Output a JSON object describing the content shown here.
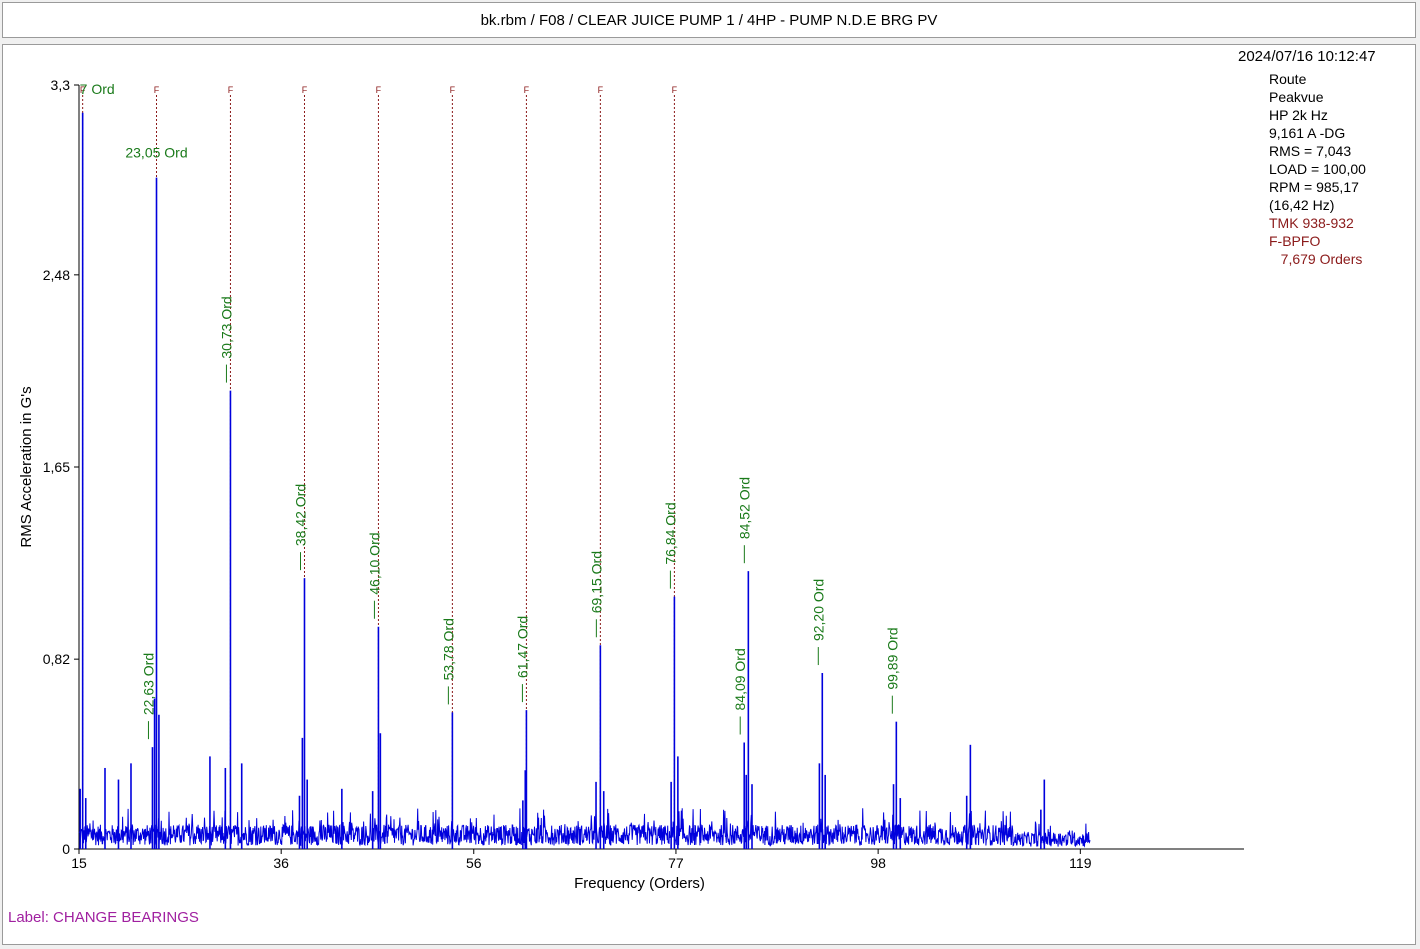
{
  "window": {
    "title": "bk.rbm / F08 / CLEAR JUICE PUMP 1 / 4HP - PUMP N.D.E BRG PV"
  },
  "info": {
    "timestamp": "2024/07/16 10:12:47",
    "lines": [
      "Route",
      "Peakvue",
      "HP 2k Hz",
      "9,161 A -DG",
      "RMS = 7,043",
      "LOAD = 100,00",
      "RPM = 985,17",
      "(16,42 Hz)"
    ],
    "fault_lines": [
      "TMK 938-932",
      "F-BPFO",
      "   7,679 Orders"
    ],
    "fault_color": "#8b1a1a"
  },
  "footer": {
    "label": "Label: CHANGE BEARINGS"
  },
  "chart_data": {
    "type": "line",
    "xlabel": "Frequency (Orders)",
    "ylabel": "RMS Acceleration in G's",
    "x_range": [
      15,
      136
    ],
    "y_range": [
      0,
      3.3
    ],
    "x_ticks": [
      15,
      36,
      56,
      77,
      98,
      119
    ],
    "x_tick_labels": [
      "15",
      "36",
      "56",
      "77",
      "98",
      "119"
    ],
    "y_ticks": [
      0,
      0.82,
      1.65,
      2.48,
      3.3
    ],
    "y_tick_labels": [
      "0",
      "0,82",
      "1,65",
      "2,48",
      "3,3"
    ],
    "series_color": "#0000dd",
    "marker_color": "#8b1a1a",
    "label_color": "#1a7a1a",
    "fault_markers": {
      "label": "F",
      "x": [
        15.38,
        23.05,
        30.73,
        38.42,
        46.1,
        53.78,
        61.47,
        69.15,
        76.84
      ]
    },
    "peak_labels": [
      {
        "x": 15.38,
        "y": 3.18,
        "text": "7 Ord",
        "orient": "h"
      },
      {
        "x": 23.05,
        "y": 2.9,
        "text": "23,05 Ord",
        "orient": "h"
      },
      {
        "x": 22.63,
        "y": 0.44,
        "text": "22,63 Ord",
        "orient": "v"
      },
      {
        "x": 30.73,
        "y": 1.98,
        "text": "30,73 Ord",
        "orient": "v"
      },
      {
        "x": 38.42,
        "y": 1.17,
        "text": "38,42 Ord",
        "orient": "v"
      },
      {
        "x": 46.1,
        "y": 0.96,
        "text": "46,10 Ord",
        "orient": "v"
      },
      {
        "x": 53.78,
        "y": 0.59,
        "text": "53,78 Ord",
        "orient": "v"
      },
      {
        "x": 61.47,
        "y": 0.6,
        "text": "61,47 Ord",
        "orient": "v"
      },
      {
        "x": 69.15,
        "y": 0.88,
        "text": "69,15 Ord",
        "orient": "v"
      },
      {
        "x": 76.84,
        "y": 1.09,
        "text": "76,84 Ord",
        "orient": "v"
      },
      {
        "x": 84.09,
        "y": 0.46,
        "text": "84,09 Ord",
        "orient": "v"
      },
      {
        "x": 84.52,
        "y": 1.2,
        "text": "84,52 Ord",
        "orient": "v"
      },
      {
        "x": 92.2,
        "y": 0.76,
        "text": "92,20 Ord",
        "orient": "v"
      },
      {
        "x": 99.89,
        "y": 0.55,
        "text": "99,89 Ord",
        "orient": "v"
      }
    ],
    "peaks": [
      {
        "x": 15.38,
        "y": 3.18
      },
      {
        "x": 15.12,
        "y": 0.26
      },
      {
        "x": 15.7,
        "y": 0.22
      },
      {
        "x": 17.7,
        "y": 0.35
      },
      {
        "x": 19.1,
        "y": 0.3
      },
      {
        "x": 20.4,
        "y": 0.37
      },
      {
        "x": 22.63,
        "y": 0.44
      },
      {
        "x": 23.05,
        "y": 2.9
      },
      {
        "x": 22.85,
        "y": 0.65
      },
      {
        "x": 23.3,
        "y": 0.58
      },
      {
        "x": 28.6,
        "y": 0.4
      },
      {
        "x": 30.2,
        "y": 0.35
      },
      {
        "x": 30.73,
        "y": 1.98
      },
      {
        "x": 31.9,
        "y": 0.37
      },
      {
        "x": 37.9,
        "y": 0.23
      },
      {
        "x": 38.2,
        "y": 0.48
      },
      {
        "x": 38.42,
        "y": 1.17
      },
      {
        "x": 38.7,
        "y": 0.3
      },
      {
        "x": 42.3,
        "y": 0.26
      },
      {
        "x": 45.5,
        "y": 0.25
      },
      {
        "x": 46.1,
        "y": 0.96
      },
      {
        "x": 46.3,
        "y": 0.5
      },
      {
        "x": 53.78,
        "y": 0.59
      },
      {
        "x": 61.1,
        "y": 0.21
      },
      {
        "x": 61.47,
        "y": 0.6
      },
      {
        "x": 61.35,
        "y": 0.34
      },
      {
        "x": 68.7,
        "y": 0.29
      },
      {
        "x": 69.15,
        "y": 0.88
      },
      {
        "x": 69.5,
        "y": 0.25
      },
      {
        "x": 76.5,
        "y": 0.29
      },
      {
        "x": 76.84,
        "y": 1.09
      },
      {
        "x": 77.2,
        "y": 0.4
      },
      {
        "x": 84.09,
        "y": 0.46
      },
      {
        "x": 84.52,
        "y": 1.2
      },
      {
        "x": 84.3,
        "y": 0.32
      },
      {
        "x": 84.9,
        "y": 0.28
      },
      {
        "x": 91.9,
        "y": 0.37
      },
      {
        "x": 92.2,
        "y": 0.76
      },
      {
        "x": 92.5,
        "y": 0.32
      },
      {
        "x": 99.6,
        "y": 0.28
      },
      {
        "x": 99.89,
        "y": 0.55
      },
      {
        "x": 100.3,
        "y": 0.22
      },
      {
        "x": 107.2,
        "y": 0.23
      },
      {
        "x": 107.58,
        "y": 0.45
      },
      {
        "x": 114.9,
        "y": 0.17
      },
      {
        "x": 115.26,
        "y": 0.3
      }
    ],
    "noise": {
      "x_start": 15,
      "x_end": 120,
      "mean": 0.05,
      "spread": 0.09
    }
  }
}
